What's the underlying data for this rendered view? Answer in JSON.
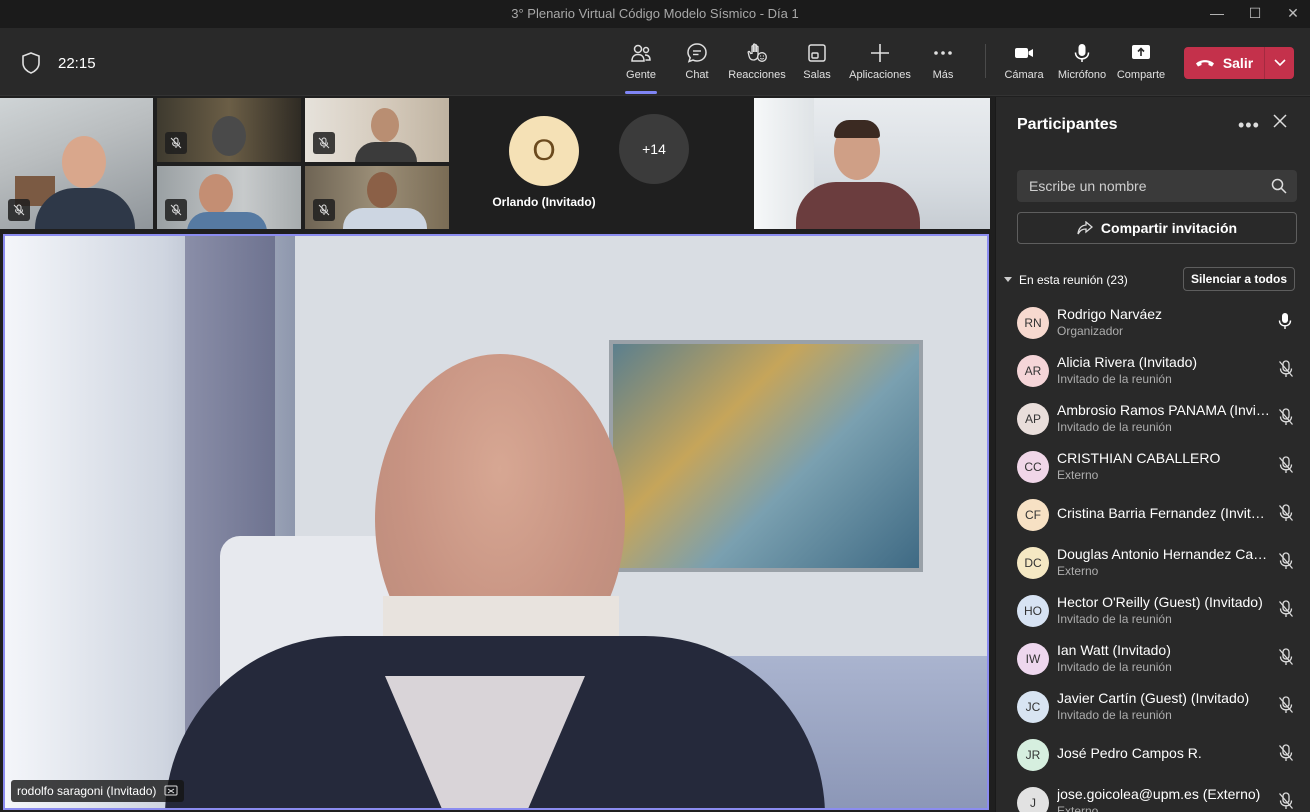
{
  "window": {
    "title": "3° Plenario Virtual Código Modelo Sísmico - Día 1"
  },
  "toolbar": {
    "time": "22:15",
    "tools": [
      {
        "id": "gente",
        "label": "Gente",
        "icon": "people-icon"
      },
      {
        "id": "chat",
        "label": "Chat",
        "icon": "chat-icon"
      },
      {
        "id": "reacciones",
        "label": "Reacciones",
        "icon": "reactions-icon"
      },
      {
        "id": "salas",
        "label": "Salas",
        "icon": "rooms-icon"
      },
      {
        "id": "aplicaciones",
        "label": "Aplicaciones",
        "icon": "plus-icon"
      },
      {
        "id": "mas",
        "label": "Más",
        "icon": "more-icon"
      },
      {
        "id": "camara",
        "label": "Cámara",
        "icon": "camera-icon"
      },
      {
        "id": "microfono",
        "label": "Micrófono",
        "icon": "mic-icon"
      },
      {
        "id": "comparte",
        "label": "Comparte",
        "icon": "share-screen-icon"
      }
    ],
    "leave_label": "Salir"
  },
  "gallery": {
    "avatar_initial": "O",
    "avatar_name": "Orlando (Invitado)",
    "more_count": "+14"
  },
  "stage": {
    "speaker_label": "rodolfo saragoni (Invitado)"
  },
  "pane": {
    "title": "Participantes",
    "search_placeholder": "Escribe un nombre",
    "share_label": "Compartir invitación",
    "section_label": "En esta reunión (23)",
    "mute_all_label": "Silenciar a todos",
    "participants": [
      {
        "initials": "RN",
        "name": "Rodrigo Narváez",
        "role": "Organizador",
        "color": "#f7d9cf",
        "muted": false
      },
      {
        "initials": "AR",
        "name": "Alicia Rivera (Invitado)",
        "role": "Invitado de la reunión",
        "color": "#f5d5d8",
        "muted": true
      },
      {
        "initials": "AP",
        "name": "Ambrosio Ramos PANAMA (Invitado)",
        "role": "Invitado de la reunión",
        "color": "#e9dedb",
        "muted": true
      },
      {
        "initials": "CC",
        "name": "CRISTHIAN CABALLERO",
        "role": "Externo",
        "color": "#f0d6e8",
        "muted": true
      },
      {
        "initials": "CF",
        "name": "Cristina Barria Fernandez (Invitado)",
        "role": "",
        "color": "#f7e1c4",
        "muted": true
      },
      {
        "initials": "DC",
        "name": "Douglas Antonio Hernandez Castillo",
        "role": "Externo",
        "color": "#f5e8c3",
        "muted": true
      },
      {
        "initials": "HO",
        "name": "Hector O'Reilly (Guest) (Invitado)",
        "role": "Invitado de la reunión",
        "color": "#d7e3f3",
        "muted": true
      },
      {
        "initials": "IW",
        "name": "Ian Watt (Invitado)",
        "role": "Invitado de la reunión",
        "color": "#eed7ee",
        "muted": true
      },
      {
        "initials": "JC",
        "name": "Javier Cartín (Guest) (Invitado)",
        "role": "Invitado de la reunión",
        "color": "#d8e4f2",
        "muted": true
      },
      {
        "initials": "JR",
        "name": "José Pedro Campos R.",
        "role": "",
        "color": "#d6efdf",
        "muted": true
      },
      {
        "initials": "J",
        "name": "jose.goicolea@upm.es (Externo)",
        "role": "Externo",
        "color": "#e2e2e2",
        "muted": true
      }
    ]
  }
}
